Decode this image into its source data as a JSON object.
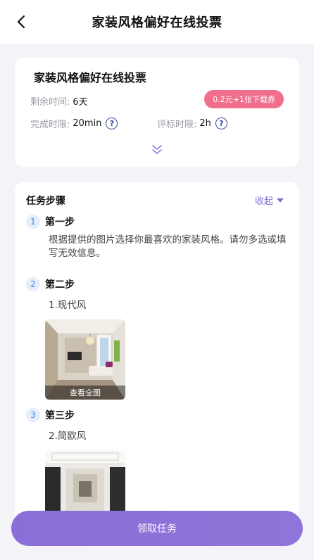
{
  "nav": {
    "title": "家装风格偏好在线投票"
  },
  "task": {
    "title": "家装风格偏好在线投票",
    "remaining_label": "剩余时间:",
    "remaining_value": "6天",
    "complete_label": "完成时限:",
    "complete_value": "20min",
    "review_label": "评标时限:",
    "review_value": "2h",
    "reward": "0.2元+1张下载券"
  },
  "steps_card": {
    "title": "任务步骤",
    "collapse_label": "收起",
    "steps": [
      {
        "num": "1",
        "name": "第一步",
        "desc": "根据提供的图片选择你最喜欢的家装风格。请勿多选或填写无效信息。"
      },
      {
        "num": "2",
        "name": "第二步",
        "sub": "1.现代风",
        "view_all": "查看全图"
      },
      {
        "num": "3",
        "name": "第三步",
        "sub": "2.简欧风"
      }
    ]
  },
  "cta": {
    "label": "领取任务"
  },
  "colors": {
    "accent": "#8a6fd8",
    "reward_bg": "#ef6f8c",
    "help_icon": "#3a4b9c",
    "step_num": "#4a86e8",
    "page_bg": "#f3f3f8"
  }
}
